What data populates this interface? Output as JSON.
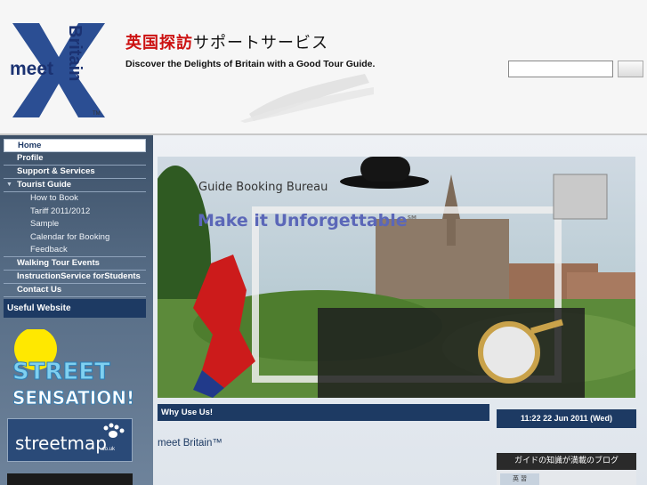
{
  "header": {
    "logo_meet": "meet",
    "logo_britain": "Britain",
    "logo_tm": "TM",
    "brand_jp_red": "英国探訪",
    "brand_jp_rest": "サポートサービス",
    "tagline": "Discover the Delights of Britain with a Good Tour Guide."
  },
  "search": {
    "placeholder": "",
    "button_label": ""
  },
  "nav": {
    "items": [
      {
        "label": "Home",
        "level": 1,
        "active": true
      },
      {
        "label": "Profile",
        "level": 1
      },
      {
        "label": "Support & Services",
        "level": 1
      },
      {
        "label": "Tourist Guide",
        "level": 1,
        "expanded": true
      },
      {
        "label": "How to Book",
        "level": 2
      },
      {
        "label": "Tariff 2011/2012",
        "level": 2
      },
      {
        "label": "Sample",
        "level": 2
      },
      {
        "label": "Calendar for Booking",
        "level": 2
      },
      {
        "label": "Feedback",
        "level": 2
      },
      {
        "label": "Walking Tour Events",
        "level": 1
      },
      {
        "label": "InstructionService forStudents",
        "level": 1
      },
      {
        "label": "Contact Us",
        "level": 1
      }
    ]
  },
  "sidebar": {
    "useful_title": "Useful Website",
    "street_line1": "STREET",
    "street_line2": "SENSATION!",
    "streetmap_label": "streetmap",
    "streetmap_domain": ".co.uk"
  },
  "hero": {
    "subtitle": "Guide Booking Bureau",
    "title": "Make it Unforgettable",
    "title_mark": "SM"
  },
  "main": {
    "why_title": "Why Use Us!",
    "datetime": "11:22  22 Jun 2011 (Wed)",
    "meet_text": "meet Britain™",
    "blog_title": "ガイドの知識が満載のブログ",
    "blog_tag": "英 習"
  },
  "colors": {
    "nav_bg": "#3c5068",
    "bar_dark": "#1d3a63",
    "accent_red": "#cc1111",
    "hero_title": "#5b67b8"
  }
}
